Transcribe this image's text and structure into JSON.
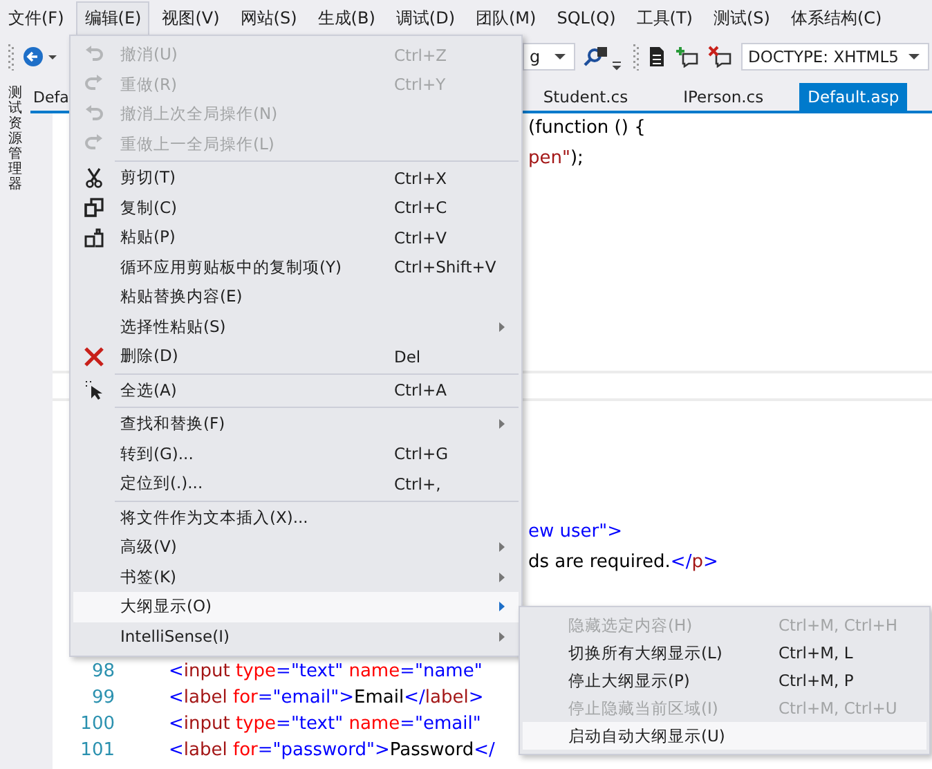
{
  "menu_bar": [
    {
      "label": "文件(F)",
      "selected": false
    },
    {
      "label": "编辑(E)",
      "selected": true
    },
    {
      "label": "视图(V)",
      "selected": false
    },
    {
      "label": "网站(S)",
      "selected": false
    },
    {
      "label": "生成(B)",
      "selected": false
    },
    {
      "label": "调试(D)",
      "selected": false
    },
    {
      "label": "团队(M)",
      "selected": false
    },
    {
      "label": "SQL(Q)",
      "selected": false
    },
    {
      "label": "工具(T)",
      "selected": false
    },
    {
      "label": "测试(S)",
      "selected": false
    },
    {
      "label": "体系结构(C)",
      "selected": false
    }
  ],
  "toolbar": {
    "config_combo": "g",
    "doctype_combo": "DOCTYPE:  XHTML5"
  },
  "side_panel": {
    "label": "测试资源管理器"
  },
  "tabs": [
    {
      "label": "Defa",
      "selected": false
    },
    {
      "label": "Student.cs",
      "selected": false
    },
    {
      "label": "IPerson.cs",
      "selected": false
    },
    {
      "label": "Default.asp",
      "selected": true
    }
  ],
  "editor": {
    "top_lines": [
      [
        {
          "kind": "plain",
          "text": "(function () {"
        }
      ],
      [
        {
          "kind": "string",
          "text": "pen\""
        },
        {
          "kind": "plain",
          "text": ");"
        }
      ]
    ],
    "bottom_lines": [
      [
        {
          "kind": "value",
          "text": "ew user\""
        },
        {
          "kind": "delim",
          "text": ">"
        }
      ],
      [
        {
          "kind": "plain",
          "text": "ds are required."
        },
        {
          "kind": "delim",
          "text": "</"
        },
        {
          "kind": "element",
          "text": "p"
        },
        {
          "kind": "delim",
          "text": ">"
        }
      ]
    ],
    "numbered_lines": [
      {
        "number": "98",
        "segments": [
          {
            "kind": "delim",
            "text": "<"
          },
          {
            "kind": "element",
            "text": "input"
          },
          {
            "kind": "attr",
            "text": " type"
          },
          {
            "kind": "delim",
            "text": "="
          },
          {
            "kind": "value",
            "text": "\"text\""
          },
          {
            "kind": "attr",
            "text": " name"
          },
          {
            "kind": "delim",
            "text": "="
          },
          {
            "kind": "value",
            "text": "\"name\""
          }
        ]
      },
      {
        "number": "99",
        "segments": [
          {
            "kind": "delim",
            "text": "<"
          },
          {
            "kind": "element",
            "text": "label"
          },
          {
            "kind": "attr",
            "text": " for"
          },
          {
            "kind": "delim",
            "text": "="
          },
          {
            "kind": "value",
            "text": "\"email\""
          },
          {
            "kind": "delim",
            "text": ">"
          },
          {
            "kind": "plain",
            "text": "Email"
          },
          {
            "kind": "delim",
            "text": "</"
          },
          {
            "kind": "element",
            "text": "label"
          },
          {
            "kind": "delim",
            "text": ">"
          }
        ]
      },
      {
        "number": "100",
        "segments": [
          {
            "kind": "delim",
            "text": "<"
          },
          {
            "kind": "element",
            "text": "input"
          },
          {
            "kind": "attr",
            "text": " type"
          },
          {
            "kind": "delim",
            "text": "="
          },
          {
            "kind": "value",
            "text": "\"text\""
          },
          {
            "kind": "attr",
            "text": " name"
          },
          {
            "kind": "delim",
            "text": "="
          },
          {
            "kind": "value",
            "text": "\"email\""
          }
        ]
      },
      {
        "number": "101",
        "segments": [
          {
            "kind": "delim",
            "text": "<"
          },
          {
            "kind": "element",
            "text": "label"
          },
          {
            "kind": "attr",
            "text": " for"
          },
          {
            "kind": "delim",
            "text": "="
          },
          {
            "kind": "value",
            "text": "\"password\""
          },
          {
            "kind": "delim",
            "text": ">"
          },
          {
            "kind": "plain",
            "text": "Password"
          },
          {
            "kind": "delim",
            "text": "</"
          }
        ]
      }
    ]
  },
  "edit_menu": {
    "sections": [
      [
        {
          "label": "撤消(U)",
          "shortcut": "Ctrl+Z",
          "kind": "undo",
          "disabled": true,
          "submenu": false,
          "selected": false
        },
        {
          "label": "重做(R)",
          "shortcut": "Ctrl+Y",
          "kind": "redo",
          "disabled": true,
          "submenu": false,
          "selected": false
        },
        {
          "label": "撤消上次全局操作(N)",
          "kind": "undo",
          "disabled": true,
          "submenu": false,
          "selected": false
        },
        {
          "label": "重做上一全局操作(L)",
          "kind": "redo",
          "disabled": true,
          "submenu": false,
          "selected": false
        }
      ],
      [
        {
          "label": "剪切(T)",
          "shortcut": "Ctrl+X",
          "kind": "cut",
          "disabled": false,
          "submenu": false,
          "selected": false
        },
        {
          "label": "复制(C)",
          "shortcut": "Ctrl+C",
          "kind": "copy",
          "disabled": false,
          "submenu": false,
          "selected": false
        },
        {
          "label": "粘贴(P)",
          "shortcut": "Ctrl+V",
          "kind": "paste",
          "disabled": false,
          "submenu": false,
          "selected": false
        },
        {
          "label": "循环应用剪贴板中的复制项(Y)",
          "shortcut": "Ctrl+Shift+V",
          "disabled": false,
          "submenu": false,
          "selected": false
        },
        {
          "label": "粘贴替换内容(E)",
          "disabled": false,
          "submenu": false,
          "selected": false
        },
        {
          "label": "选择性粘贴(S)",
          "disabled": false,
          "submenu": true,
          "selected": false
        },
        {
          "label": "删除(D)",
          "shortcut": "Del",
          "kind": "delete",
          "disabled": false,
          "submenu": false,
          "selected": false
        }
      ],
      [
        {
          "label": "全选(A)",
          "shortcut": "Ctrl+A",
          "kind": "select_all",
          "disabled": false,
          "submenu": false,
          "selected": false
        }
      ],
      [
        {
          "label": "查找和替换(F)",
          "disabled": false,
          "submenu": true,
          "selected": false
        },
        {
          "label": "转到(G)...",
          "shortcut": "Ctrl+G",
          "disabled": false,
          "submenu": false,
          "selected": false
        },
        {
          "label": "定位到(.)...",
          "shortcut": "Ctrl+,",
          "disabled": false,
          "submenu": false,
          "selected": false
        }
      ],
      [
        {
          "label": "将文件作为文本插入(X)...",
          "disabled": false,
          "submenu": false,
          "selected": false
        },
        {
          "label": "高级(V)",
          "disabled": false,
          "submenu": true,
          "selected": false
        },
        {
          "label": "书签(K)",
          "disabled": false,
          "submenu": true,
          "selected": false
        },
        {
          "label": "大纲显示(O)",
          "disabled": false,
          "submenu": true,
          "selected": true
        },
        {
          "label": "IntelliSense(I)",
          "disabled": false,
          "submenu": true,
          "selected": false
        }
      ]
    ]
  },
  "outline_submenu": [
    {
      "label": "隐藏选定内容(H)",
      "shortcut": "Ctrl+M, Ctrl+H",
      "disabled": true,
      "selected": false
    },
    {
      "label": "切换所有大纲显示(L)",
      "shortcut": "Ctrl+M, L",
      "disabled": false,
      "selected": false
    },
    {
      "label": "停止大纲显示(P)",
      "shortcut": "Ctrl+M, P",
      "disabled": false,
      "selected": false
    },
    {
      "label": "停止隐藏当前区域(I)",
      "shortcut": "Ctrl+M, Ctrl+U",
      "disabled": true,
      "selected": false
    },
    {
      "label": "启动自动大纲显示(U)",
      "disabled": false,
      "selected": true
    }
  ]
}
